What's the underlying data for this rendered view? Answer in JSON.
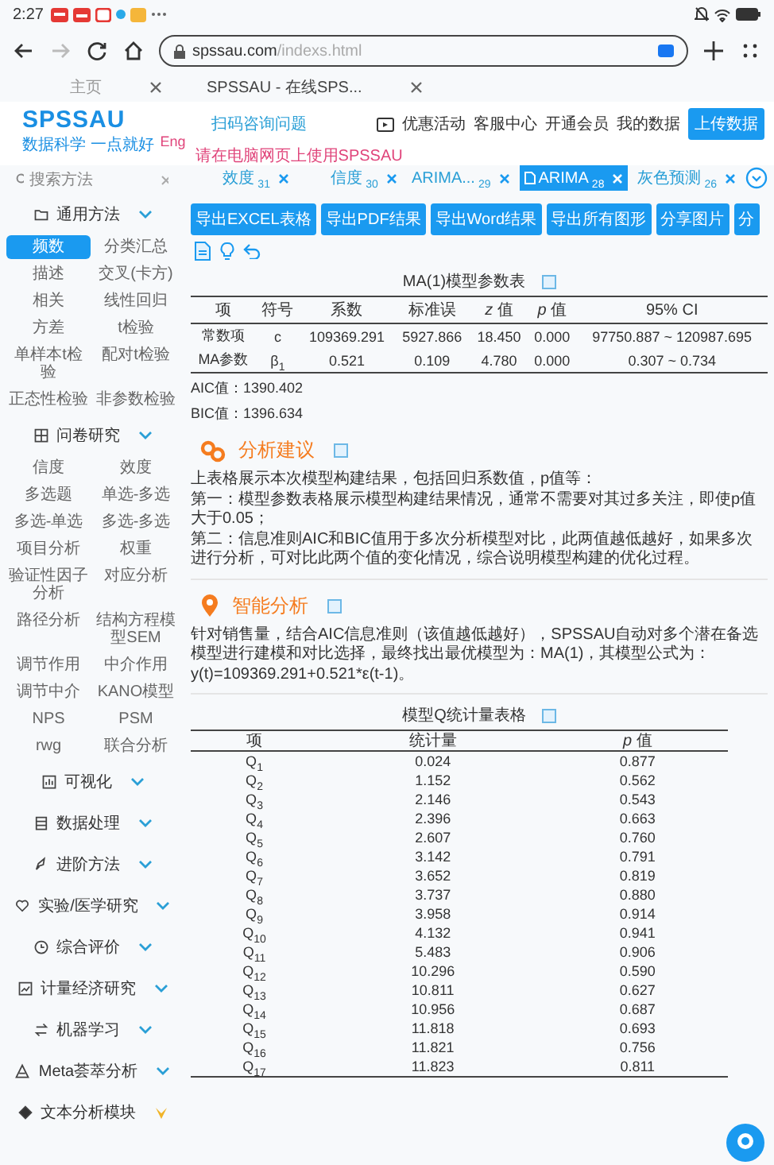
{
  "status_bar": {
    "time": "2:27"
  },
  "browser": {
    "url_host": "spssau.com",
    "url_path": "/indexs.html",
    "tabs": [
      {
        "label": "主页",
        "selected": false
      },
      {
        "label": "SPSSAU - 在线SPS...",
        "selected": true
      }
    ]
  },
  "header": {
    "logo": "SPSSAU",
    "slogan": "数据科学 一点就好",
    "lang": "Eng",
    "qr_hint": "扫码咨询问题",
    "notice": "请在电脑网页上使用SPSSAU",
    "nav": [
      "优惠活动",
      "客服中心",
      "开通会员",
      "我的数据"
    ],
    "upload_button": "上传数据"
  },
  "sidebar": {
    "search": {
      "placeholder": "搜索方法"
    },
    "sections": [
      {
        "title": "通用方法",
        "kind": "group",
        "items": [
          {
            "label": "频数",
            "selected": true
          },
          {
            "label": "分类汇总",
            "selected": false
          },
          {
            "label": "描述",
            "selected": false
          },
          {
            "label": "交叉(卡方)",
            "selected": false
          },
          {
            "label": "相关",
            "selected": false
          },
          {
            "label": "线性回归",
            "selected": false
          },
          {
            "label": "方差",
            "selected": false
          },
          {
            "label": "t检验",
            "selected": false
          },
          {
            "label": "单样本t检验",
            "selected": false
          },
          {
            "label": "配对t检验",
            "selected": false
          },
          {
            "label": "正态性检验",
            "selected": false
          },
          {
            "label": "非参数检验",
            "selected": false
          }
        ]
      },
      {
        "title": "问卷研究",
        "kind": "group",
        "items": [
          {
            "label": "信度",
            "selected": false
          },
          {
            "label": "效度",
            "selected": false
          },
          {
            "label": "多选题",
            "selected": false
          },
          {
            "label": "单选-多选",
            "selected": false
          },
          {
            "label": "多选-单选",
            "selected": false
          },
          {
            "label": "多选-多选",
            "selected": false
          },
          {
            "label": "项目分析",
            "selected": false
          },
          {
            "label": "权重",
            "selected": false
          },
          {
            "label": "验证性因子分析",
            "selected": false
          },
          {
            "label": "对应分析",
            "selected": false
          },
          {
            "label": "路径分析",
            "selected": false
          },
          {
            "label": "结构方程模型SEM",
            "selected": false
          },
          {
            "label": "调节作用",
            "selected": false
          },
          {
            "label": "中介作用",
            "selected": false
          },
          {
            "label": "调节中介",
            "selected": false
          },
          {
            "label": "KANO模型",
            "selected": false
          },
          {
            "label": "NPS",
            "selected": false
          },
          {
            "label": "PSM",
            "selected": false
          },
          {
            "label": "rwg",
            "selected": false
          },
          {
            "label": "联合分析",
            "selected": false
          }
        ]
      },
      {
        "title": "可视化",
        "kind": "group"
      },
      {
        "title": "数据处理",
        "kind": "group"
      },
      {
        "title": "进阶方法",
        "kind": "group"
      },
      {
        "title": "实验/医学研究",
        "kind": "group"
      },
      {
        "title": "综合评价",
        "kind": "group"
      },
      {
        "title": "计量经济研究",
        "kind": "group"
      },
      {
        "title": "机器学习",
        "kind": "group"
      },
      {
        "title": "Meta荟萃分析",
        "kind": "group"
      },
      {
        "title": "文本分析模块",
        "kind": "module"
      }
    ]
  },
  "method_tabs": [
    {
      "label": "效度",
      "count": "31",
      "selected": false
    },
    {
      "label": "信度",
      "count": "30",
      "selected": false
    },
    {
      "label": "ARIMA...",
      "count": "29",
      "selected": false
    },
    {
      "label": "ARIMA",
      "count": "28",
      "selected": true
    },
    {
      "label": "灰色预测",
      "count": "26",
      "selected": false
    }
  ],
  "toolbar": {
    "buttons": [
      "导出EXCEL表格",
      "导出PDF结果",
      "导出Word结果",
      "导出所有图形",
      "分享图片",
      "分"
    ]
  },
  "param_table": {
    "title": "MA(1)模型参数表",
    "columns": [
      "项",
      "符号",
      "系数",
      "标准误",
      "*z* 值",
      "*p* 值",
      "95% CI"
    ],
    "rows": [
      [
        "常数项",
        "c",
        "109369.291",
        "5927.866",
        "18.450",
        "0.000",
        "97750.887 ~ 120987.695"
      ],
      [
        "MA参数",
        "β$_{1}$",
        "0.521",
        "0.109",
        "4.780",
        "0.000",
        "0.307 ~ 0.734"
      ]
    ]
  },
  "fit_stats": [
    "AIC值：1390.402",
    "BIC值：1396.634"
  ],
  "advice": {
    "title": "分析建议",
    "paragraphs": [
      "上表格展示本次模型构建结果，包括回归系数值，p值等：",
      "第一：模型参数表格展示模型构建结果情况，通常不需要对其过多关注，即使p值大于0.05；",
      "第二：信息准则AIC和BIC值用于多次分析模型对比，此两值越低越好，如果多次进行分析，可对比此两个值的变化情况，综合说明模型构建的优化过程。"
    ]
  },
  "smart": {
    "title": "智能分析",
    "paragraphs": [
      "针对销售量，结合AIC信息准则（该值越低越好），SPSSAU自动对多个潜在备选模型进行建模和对比选择，最终找出最优模型为：MA(1)，其模型公式为：y(t)=109369.291+0.521*ε(t-1)。"
    ]
  },
  "q_table": {
    "title": "模型Q统计量表格",
    "columns": [
      "项",
      "统计量",
      "*p* 值"
    ],
    "rows": [
      [
        "Q$_{1}$",
        "0.024",
        "0.877"
      ],
      [
        "Q$_{2}$",
        "1.152",
        "0.562"
      ],
      [
        "Q$_{3}$",
        "2.146",
        "0.543"
      ],
      [
        "Q$_{4}$",
        "2.396",
        "0.663"
      ],
      [
        "Q$_{5}$",
        "2.607",
        "0.760"
      ],
      [
        "Q$_{6}$",
        "3.142",
        "0.791"
      ],
      [
        "Q$_{7}$",
        "3.652",
        "0.819"
      ],
      [
        "Q$_{8}$",
        "3.737",
        "0.880"
      ],
      [
        "Q$_{9}$",
        "3.958",
        "0.914"
      ],
      [
        "Q$_{10}$",
        "4.132",
        "0.941"
      ],
      [
        "Q$_{11}$",
        "5.483",
        "0.906"
      ],
      [
        "Q$_{12}$",
        "10.296",
        "0.590"
      ],
      [
        "Q$_{13}$",
        "10.811",
        "0.627"
      ],
      [
        "Q$_{14}$",
        "10.956",
        "0.687"
      ],
      [
        "Q$_{15}$",
        "11.818",
        "0.693"
      ],
      [
        "Q$_{16}$",
        "11.821",
        "0.756"
      ],
      [
        "Q$_{17}$",
        "11.823",
        "0.811"
      ]
    ]
  }
}
